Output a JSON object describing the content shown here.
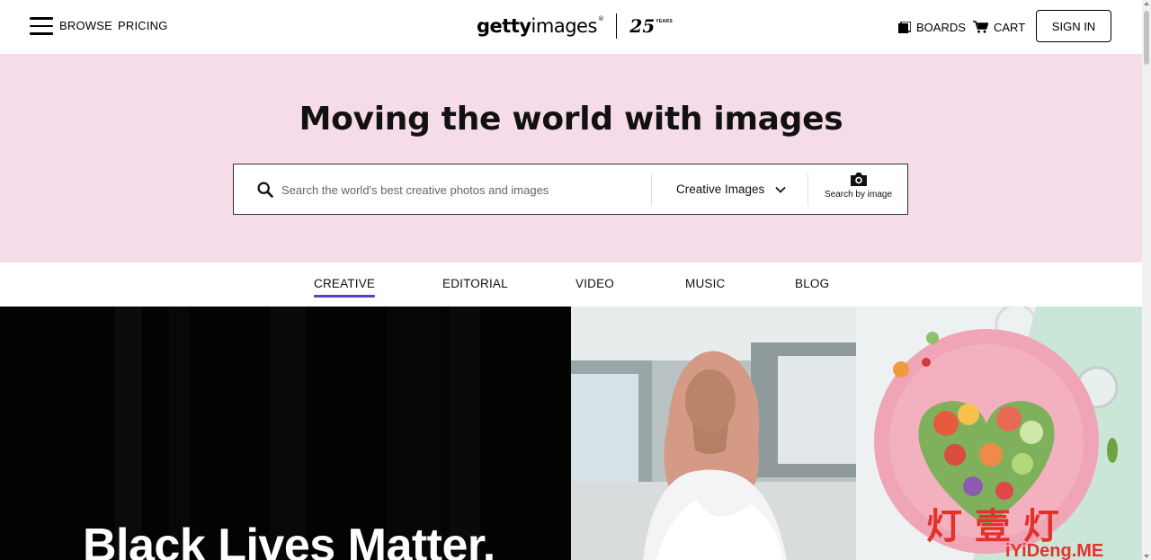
{
  "header": {
    "browse_label": "BROWSE",
    "pricing_label": "PRICING",
    "logo": {
      "word_bold": "getty",
      "word_light": "images",
      "reg": "®",
      "years_number": "25",
      "years_label": "YEARS"
    },
    "boards_label": "BOARDS",
    "cart_label": "CART",
    "sign_in_label": "SIGN IN"
  },
  "hero": {
    "title": "Moving the world with images",
    "search": {
      "placeholder": "Search the world's best creative photos and images",
      "type_selected": "Creative Images",
      "by_image_label": "Search by image"
    },
    "background_color": "#f6dbe9"
  },
  "tabs": [
    {
      "label": "CREATIVE",
      "active": true
    },
    {
      "label": "EDITORIAL",
      "active": false
    },
    {
      "label": "VIDEO",
      "active": false
    },
    {
      "label": "MUSIC",
      "active": false
    },
    {
      "label": "BLOG",
      "active": false
    }
  ],
  "feature": {
    "headline": "Black Lives Matter.",
    "accent_color": "#5b3fd1"
  },
  "watermark": {
    "glyphs": "灯 壹 灯",
    "text": "iYiDeng.ME"
  },
  "icons": [
    "menu-icon",
    "boards-icon",
    "cart-icon",
    "search-icon",
    "chevron-down-icon",
    "camera-icon"
  ]
}
